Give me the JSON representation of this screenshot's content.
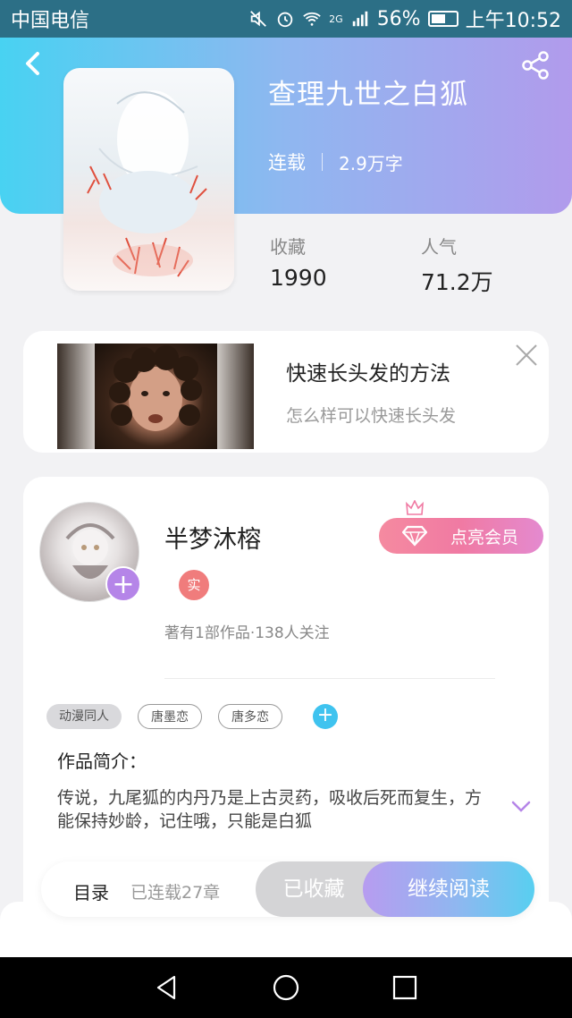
{
  "status_bar": {
    "carrier": "中国电信",
    "network": "2G",
    "battery": "56%",
    "time": "上午10:52"
  },
  "book": {
    "title": "查理九世之白狐",
    "status": "连载",
    "word_count": "2.9万字",
    "favorites_label": "收藏",
    "favorites_value": "1990",
    "popularity_label": "人气",
    "popularity_value": "71.2万"
  },
  "ad": {
    "title": "快速长头发的方法",
    "subtitle": "怎么样可以快速长头发"
  },
  "author": {
    "name": "半梦沐榕",
    "verified_badge": "实",
    "stats": "著有1部作品·138人关注",
    "vip_button": "点亮会员"
  },
  "tags": [
    "动漫同人",
    "唐墨恋",
    "唐多恋"
  ],
  "intro": {
    "title": "作品简介：",
    "text": "传说，九尾狐的内丹乃是上古灵药，吸收后死而复生，方能保持妙龄，记住哦，只能是白狐"
  },
  "bottom_bar": {
    "toc_label": "目录",
    "toc_status": "已连载27章",
    "collected_label": "已收藏",
    "read_label": "继续阅读"
  },
  "colors": {
    "header_gradient_start": "#48d2f2",
    "header_gradient_end": "#b19bec",
    "vip_pink": "#f07aa3",
    "tag_add_blue": "#3fc3ef",
    "avatar_plus_purple": "#b585e8"
  }
}
